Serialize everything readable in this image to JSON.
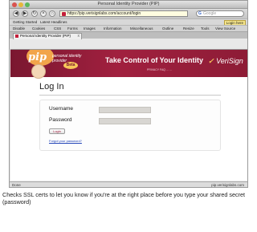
{
  "window": {
    "title": "Personal Identity Provider (PIP)"
  },
  "navbar": {
    "back": "◀",
    "forward": "▶",
    "url": "https://pip.verisignlabs.com/account/login",
    "search_placeholder": "Google",
    "search_engine_glyph": "G"
  },
  "bookmarks_toolbar": {
    "items": [
      "Getting Started",
      "Latest Headlines"
    ],
    "right_button": "Login here"
  },
  "developer_toolbar": {
    "items": [
      "Disable",
      "Cookies",
      "CSS",
      "Forms",
      "Images",
      "Information",
      "Miscellaneous",
      "Outline",
      "Resize",
      "Tools",
      "View Source"
    ]
  },
  "tab": {
    "label": "Personal Identity Provider (PIP)",
    "close": "x"
  },
  "banner": {
    "logo": "pip",
    "brand_line1": "personal identity",
    "brand_line2": "provider",
    "beta": "Beta",
    "headline": "Take Control of Your Identity",
    "links": "PRIVACY   FAQ   ...   ...",
    "verisign": "VeriSign",
    "verisign_check": "✓"
  },
  "login": {
    "title": "Log In",
    "username_label": "Username",
    "password_label": "Password",
    "button": "Login",
    "forgot": "Forgot your password?"
  },
  "statusbar": {
    "left": "Done",
    "right": "pip.verisignlabs.com"
  },
  "caption": "Checks SSL certs to let you know if you're at the right place before you type your shared secret (password)",
  "colors": {
    "banner": "#a1203f",
    "banner_dark": "#7a1730",
    "accent": "#f2a54a",
    "link": "#2446b8"
  }
}
